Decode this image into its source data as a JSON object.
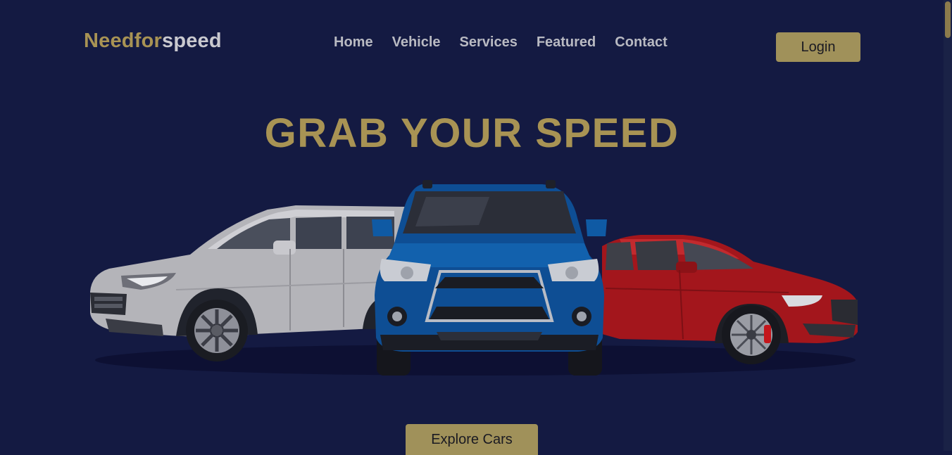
{
  "header": {
    "logo_part1": "Needfor",
    "logo_part2": "speed",
    "nav": [
      "Home",
      "Vehicle",
      "Services",
      "Featured",
      "Contact"
    ],
    "login_label": "Login"
  },
  "hero": {
    "title": "GRAB YOUR SPEED",
    "explore_label": "Explore Cars",
    "cars": [
      {
        "name": "white-suv-image",
        "color": "#b8b8bc"
      },
      {
        "name": "blue-suv-image",
        "color": "#0e4f93"
      },
      {
        "name": "red-sedan-image",
        "color": "#a4161c"
      }
    ]
  },
  "colors": {
    "background": "#141a42",
    "accent": "#a89354",
    "button": "#a0915a",
    "nav_text": "#b9bac2"
  }
}
